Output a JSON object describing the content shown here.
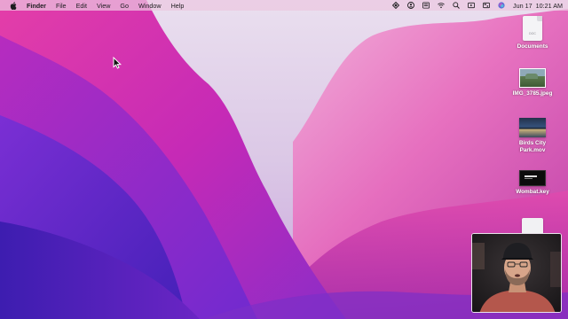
{
  "menubar": {
    "app_name": "Finder",
    "menus": [
      "File",
      "Edit",
      "View",
      "Go",
      "Window",
      "Help"
    ],
    "status_icons": [
      "screen-share-icon",
      "user-icon",
      "keyboard-icon",
      "wifi-icon",
      "search-icon",
      "video-record-icon",
      "control-center-icon",
      "siri-icon"
    ],
    "date": "Jun 17",
    "time": "10:21 AM"
  },
  "desktop": {
    "icons": [
      {
        "name": "documents",
        "label": "Documents",
        "kind": "document",
        "ext": "DOC"
      },
      {
        "name": "img-3785",
        "label": "IMG_3785.jpeg",
        "kind": "photo"
      },
      {
        "name": "birds-city-park",
        "label": "Birds City Park.mov",
        "kind": "video"
      },
      {
        "name": "wombat-key",
        "label": "Wombat.key",
        "kind": "keynote"
      },
      {
        "name": "untitled-doc",
        "label": "",
        "kind": "document-partial"
      }
    ]
  },
  "colors": {
    "menubar_bg": "#ebc8e1",
    "wallpaper_top": "#e4d8ea",
    "wallpaper_magenta": "#e22fb0",
    "wallpaper_purple": "#6a2ed0",
    "wallpaper_deep": "#3a1fb6"
  }
}
